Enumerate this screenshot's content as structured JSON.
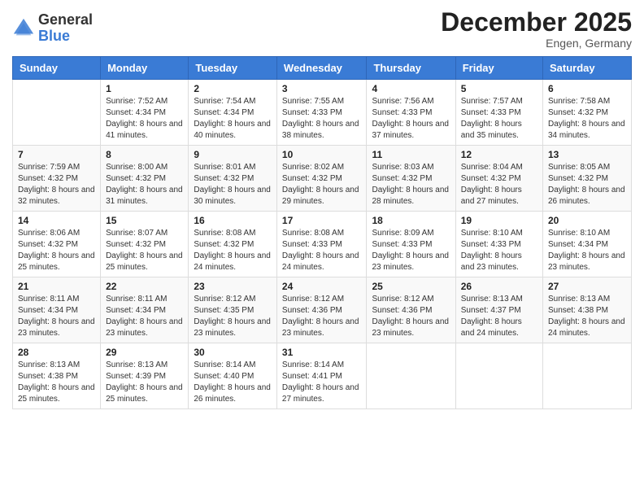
{
  "header": {
    "logo": {
      "general": "General",
      "blue": "Blue"
    },
    "title": "December 2025",
    "location": "Engen, Germany"
  },
  "weekdays": [
    "Sunday",
    "Monday",
    "Tuesday",
    "Wednesday",
    "Thursday",
    "Friday",
    "Saturday"
  ],
  "weeks": [
    [
      {
        "day": "",
        "sunrise": "",
        "sunset": "",
        "daylight": ""
      },
      {
        "day": "1",
        "sunrise": "Sunrise: 7:52 AM",
        "sunset": "Sunset: 4:34 PM",
        "daylight": "Daylight: 8 hours and 41 minutes."
      },
      {
        "day": "2",
        "sunrise": "Sunrise: 7:54 AM",
        "sunset": "Sunset: 4:34 PM",
        "daylight": "Daylight: 8 hours and 40 minutes."
      },
      {
        "day": "3",
        "sunrise": "Sunrise: 7:55 AM",
        "sunset": "Sunset: 4:33 PM",
        "daylight": "Daylight: 8 hours and 38 minutes."
      },
      {
        "day": "4",
        "sunrise": "Sunrise: 7:56 AM",
        "sunset": "Sunset: 4:33 PM",
        "daylight": "Daylight: 8 hours and 37 minutes."
      },
      {
        "day": "5",
        "sunrise": "Sunrise: 7:57 AM",
        "sunset": "Sunset: 4:33 PM",
        "daylight": "Daylight: 8 hours and 35 minutes."
      },
      {
        "day": "6",
        "sunrise": "Sunrise: 7:58 AM",
        "sunset": "Sunset: 4:32 PM",
        "daylight": "Daylight: 8 hours and 34 minutes."
      }
    ],
    [
      {
        "day": "7",
        "sunrise": "Sunrise: 7:59 AM",
        "sunset": "Sunset: 4:32 PM",
        "daylight": "Daylight: 8 hours and 32 minutes."
      },
      {
        "day": "8",
        "sunrise": "Sunrise: 8:00 AM",
        "sunset": "Sunset: 4:32 PM",
        "daylight": "Daylight: 8 hours and 31 minutes."
      },
      {
        "day": "9",
        "sunrise": "Sunrise: 8:01 AM",
        "sunset": "Sunset: 4:32 PM",
        "daylight": "Daylight: 8 hours and 30 minutes."
      },
      {
        "day": "10",
        "sunrise": "Sunrise: 8:02 AM",
        "sunset": "Sunset: 4:32 PM",
        "daylight": "Daylight: 8 hours and 29 minutes."
      },
      {
        "day": "11",
        "sunrise": "Sunrise: 8:03 AM",
        "sunset": "Sunset: 4:32 PM",
        "daylight": "Daylight: 8 hours and 28 minutes."
      },
      {
        "day": "12",
        "sunrise": "Sunrise: 8:04 AM",
        "sunset": "Sunset: 4:32 PM",
        "daylight": "Daylight: 8 hours and 27 minutes."
      },
      {
        "day": "13",
        "sunrise": "Sunrise: 8:05 AM",
        "sunset": "Sunset: 4:32 PM",
        "daylight": "Daylight: 8 hours and 26 minutes."
      }
    ],
    [
      {
        "day": "14",
        "sunrise": "Sunrise: 8:06 AM",
        "sunset": "Sunset: 4:32 PM",
        "daylight": "Daylight: 8 hours and 25 minutes."
      },
      {
        "day": "15",
        "sunrise": "Sunrise: 8:07 AM",
        "sunset": "Sunset: 4:32 PM",
        "daylight": "Daylight: 8 hours and 25 minutes."
      },
      {
        "day": "16",
        "sunrise": "Sunrise: 8:08 AM",
        "sunset": "Sunset: 4:32 PM",
        "daylight": "Daylight: 8 hours and 24 minutes."
      },
      {
        "day": "17",
        "sunrise": "Sunrise: 8:08 AM",
        "sunset": "Sunset: 4:33 PM",
        "daylight": "Daylight: 8 hours and 24 minutes."
      },
      {
        "day": "18",
        "sunrise": "Sunrise: 8:09 AM",
        "sunset": "Sunset: 4:33 PM",
        "daylight": "Daylight: 8 hours and 23 minutes."
      },
      {
        "day": "19",
        "sunrise": "Sunrise: 8:10 AM",
        "sunset": "Sunset: 4:33 PM",
        "daylight": "Daylight: 8 hours and 23 minutes."
      },
      {
        "day": "20",
        "sunrise": "Sunrise: 8:10 AM",
        "sunset": "Sunset: 4:34 PM",
        "daylight": "Daylight: 8 hours and 23 minutes."
      }
    ],
    [
      {
        "day": "21",
        "sunrise": "Sunrise: 8:11 AM",
        "sunset": "Sunset: 4:34 PM",
        "daylight": "Daylight: 8 hours and 23 minutes."
      },
      {
        "day": "22",
        "sunrise": "Sunrise: 8:11 AM",
        "sunset": "Sunset: 4:34 PM",
        "daylight": "Daylight: 8 hours and 23 minutes."
      },
      {
        "day": "23",
        "sunrise": "Sunrise: 8:12 AM",
        "sunset": "Sunset: 4:35 PM",
        "daylight": "Daylight: 8 hours and 23 minutes."
      },
      {
        "day": "24",
        "sunrise": "Sunrise: 8:12 AM",
        "sunset": "Sunset: 4:36 PM",
        "daylight": "Daylight: 8 hours and 23 minutes."
      },
      {
        "day": "25",
        "sunrise": "Sunrise: 8:12 AM",
        "sunset": "Sunset: 4:36 PM",
        "daylight": "Daylight: 8 hours and 23 minutes."
      },
      {
        "day": "26",
        "sunrise": "Sunrise: 8:13 AM",
        "sunset": "Sunset: 4:37 PM",
        "daylight": "Daylight: 8 hours and 24 minutes."
      },
      {
        "day": "27",
        "sunrise": "Sunrise: 8:13 AM",
        "sunset": "Sunset: 4:38 PM",
        "daylight": "Daylight: 8 hours and 24 minutes."
      }
    ],
    [
      {
        "day": "28",
        "sunrise": "Sunrise: 8:13 AM",
        "sunset": "Sunset: 4:38 PM",
        "daylight": "Daylight: 8 hours and 25 minutes."
      },
      {
        "day": "29",
        "sunrise": "Sunrise: 8:13 AM",
        "sunset": "Sunset: 4:39 PM",
        "daylight": "Daylight: 8 hours and 25 minutes."
      },
      {
        "day": "30",
        "sunrise": "Sunrise: 8:14 AM",
        "sunset": "Sunset: 4:40 PM",
        "daylight": "Daylight: 8 hours and 26 minutes."
      },
      {
        "day": "31",
        "sunrise": "Sunrise: 8:14 AM",
        "sunset": "Sunset: 4:41 PM",
        "daylight": "Daylight: 8 hours and 27 minutes."
      },
      {
        "day": "",
        "sunrise": "",
        "sunset": "",
        "daylight": ""
      },
      {
        "day": "",
        "sunrise": "",
        "sunset": "",
        "daylight": ""
      },
      {
        "day": "",
        "sunrise": "",
        "sunset": "",
        "daylight": ""
      }
    ]
  ]
}
